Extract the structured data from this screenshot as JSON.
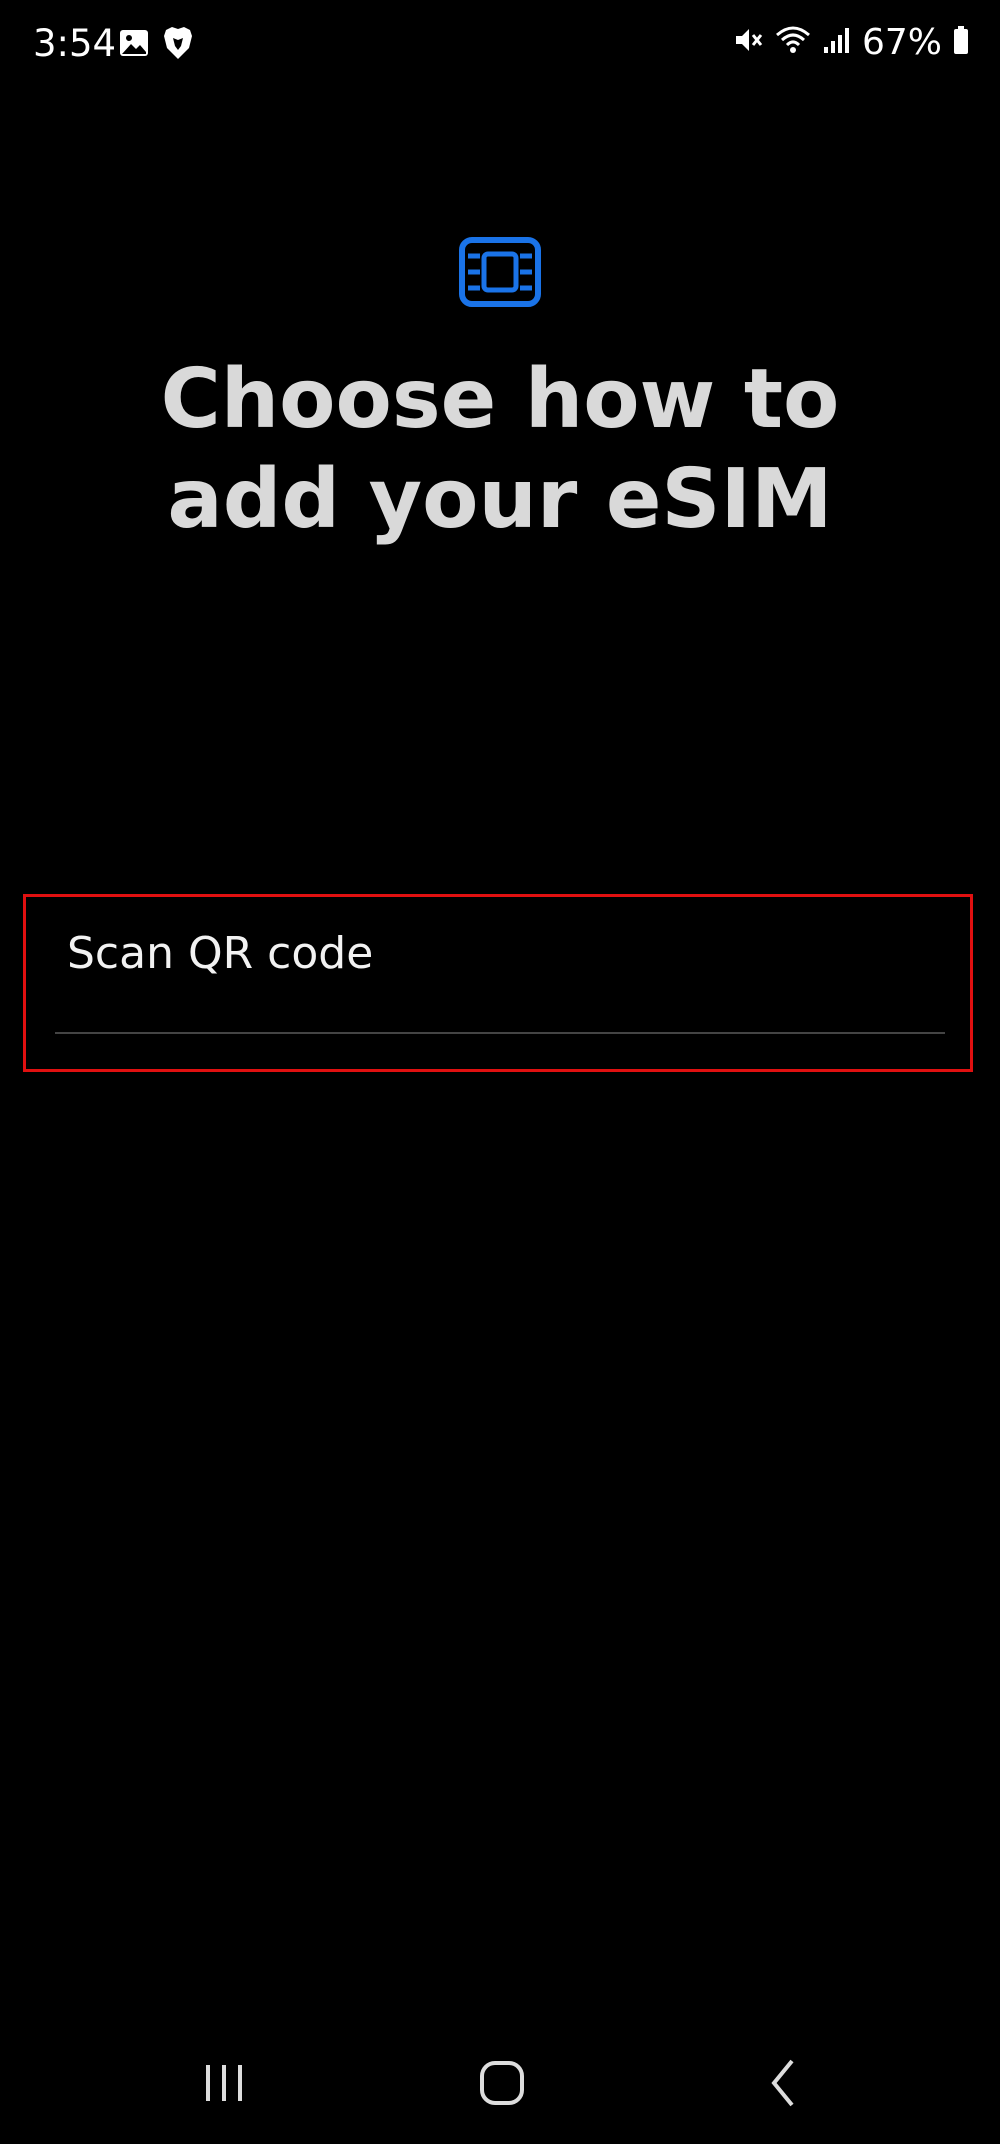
{
  "status_bar": {
    "time": "3:54",
    "battery": "67%",
    "icons": [
      "gallery-icon",
      "brave-browser-icon",
      "mute-icon",
      "wifi-icon",
      "signal-icon",
      "battery-icon"
    ]
  },
  "header": {
    "icon": "esim-icon",
    "icon_color": "#1a73e8",
    "title": "Choose how to add your eSIM"
  },
  "options": [
    {
      "label": "Scan QR code"
    }
  ],
  "highlight_color": "#e01010",
  "nav_bar": {
    "icons": [
      "recent-apps-icon",
      "home-icon",
      "back-icon"
    ]
  }
}
